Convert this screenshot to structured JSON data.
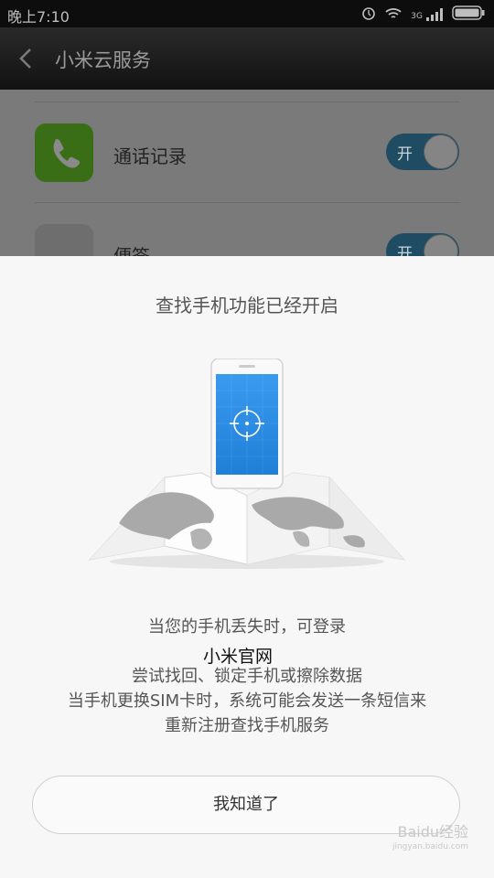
{
  "status_bar": {
    "time": "晚上7:10",
    "network": "3G"
  },
  "header": {
    "title": "小米云服务"
  },
  "settings": {
    "items": [
      {
        "label": "通话记录",
        "toggle_label": "开"
      },
      {
        "label": "便签",
        "toggle_label": "开"
      }
    ]
  },
  "dialog": {
    "title": "查找手机功能已经开启",
    "description": [
      "当您的手机丢失时，可登录",
      "",
      "尝试找回、锁定手机或擦除数据",
      "当手机更换SIM卡时，系统可能会发送一条短信来",
      "重新注册查找手机服务"
    ],
    "overlay_text": "小米官网",
    "button_label": "我知道了"
  },
  "watermark": {
    "brand": "Baidu经验",
    "url": "jingyan.baidu.com"
  },
  "colors": {
    "sheet_bg": "#f7f7f7",
    "toggle_on": "#1f4c63",
    "phone_screen": "#2f8fe0"
  }
}
